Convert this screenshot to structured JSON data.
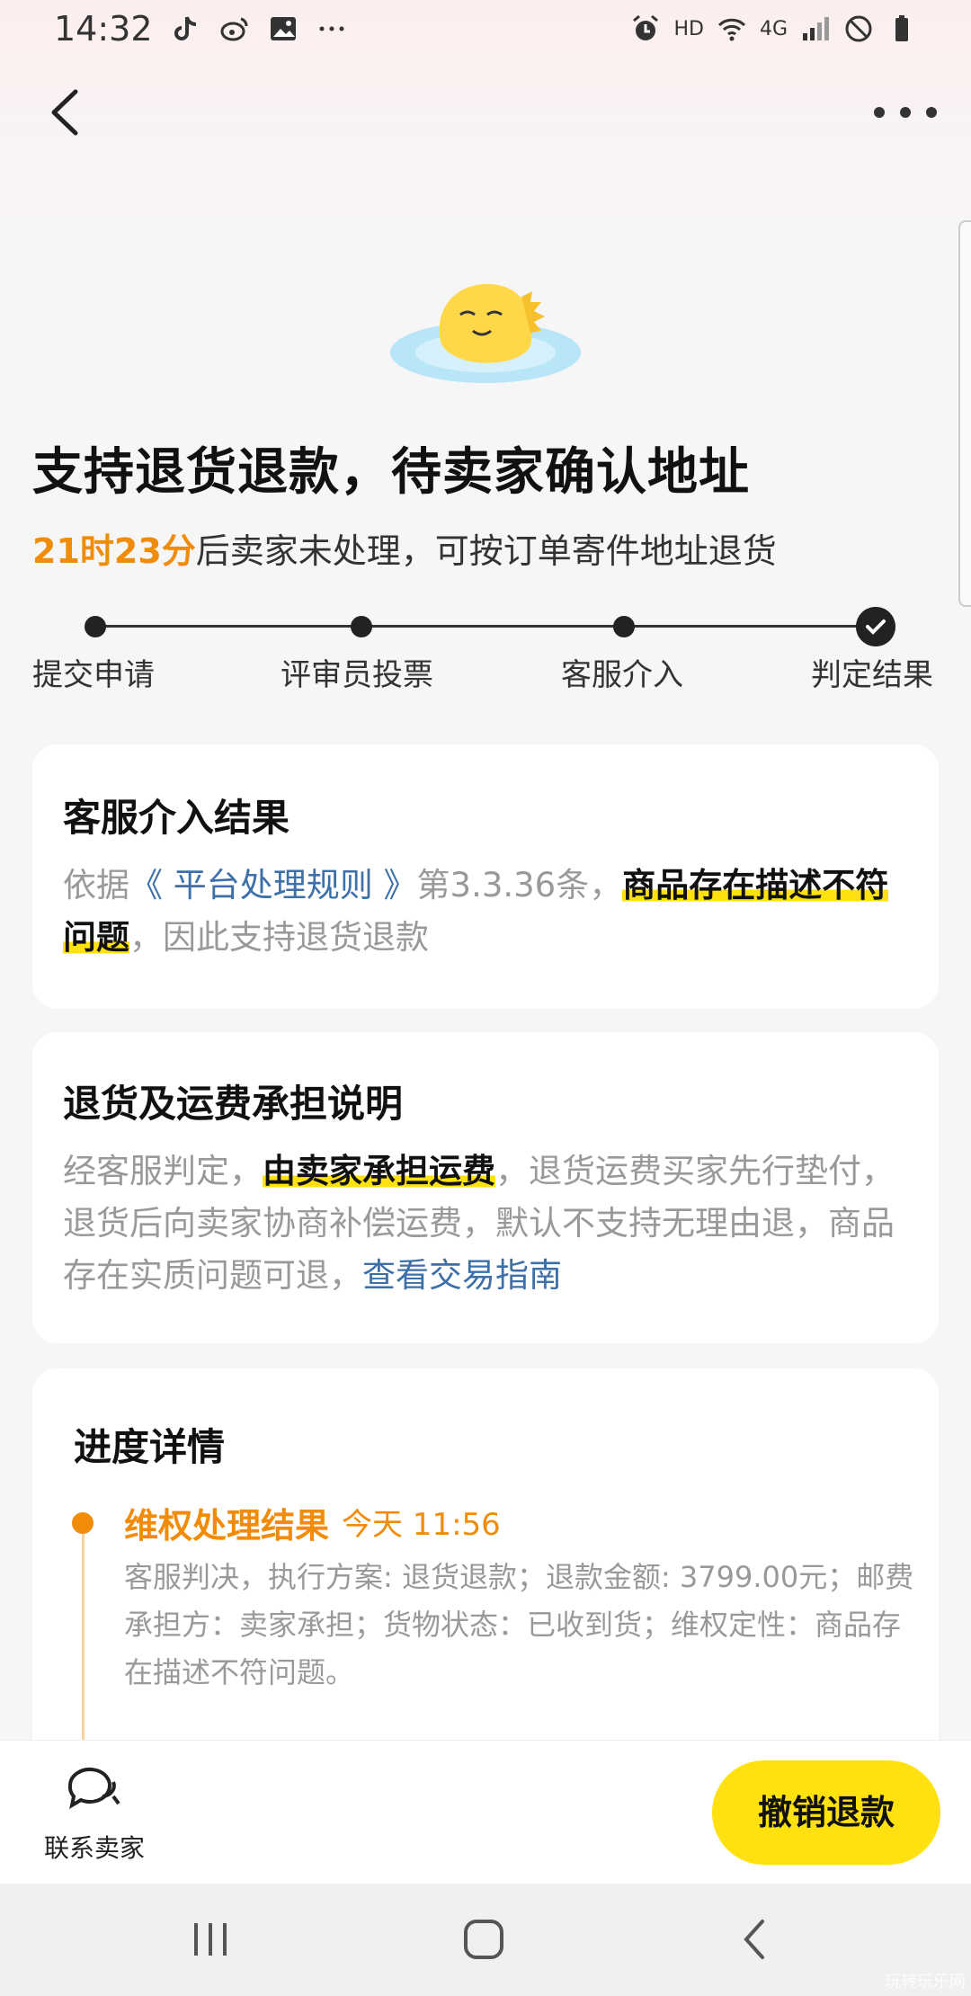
{
  "status_bar": {
    "time": "14:32",
    "hd": "HD",
    "net": "4G"
  },
  "header": {
    "title": "支持退货退款，待卖家确认地址",
    "countdown": "21时23分",
    "subtitle_rest": "后卖家未处理，可按订单寄件地址退货"
  },
  "steps": [
    {
      "label": "提交申请"
    },
    {
      "label": "评审员投票"
    },
    {
      "label": "客服介入"
    },
    {
      "label": "判定结果"
    }
  ],
  "result_card": {
    "title": "客服介入结果",
    "text_prefix": "依据",
    "rule_link": "《 平台处理规则 》",
    "text_mid": "第3.3.36条，",
    "highlight": "商品存在描述不符问题",
    "text_suffix": "，因此支持退货退款"
  },
  "shipping_card": {
    "title": "退货及运费承担说明",
    "text_prefix": "经客服判定，",
    "highlight": "由卖家承担运费",
    "text_mid": "，退货运费买家先行垫付，退货后向卖家协商补偿运费，默认不支持无理由退，商品存在实质问题可退，",
    "guide_link": "查看交易指南"
  },
  "progress_card": {
    "title": "进度详情",
    "items": [
      {
        "title": "维权处理结果",
        "time": "今天 11:56",
        "desc": "客服判决，执行方案: 退货退款；退款金额: 3799.00元；邮费承担方：卖家承担；货物状态：已收到货；维权定性：商品存在描述不符问题。"
      }
    ]
  },
  "bottom_bar": {
    "contact_label": "联系卖家",
    "cancel_label": "撤销退款"
  },
  "icons": {
    "back": "back-arrow-icon",
    "more": "more-dots-icon",
    "contact": "chat-bubbles-icon",
    "step_done": "check-icon"
  },
  "colors": {
    "accent_orange": "#f08c0a",
    "button_yellow": "#ffe10f",
    "link_blue": "#3d6fa8"
  },
  "watermark": "玩转玩乐网"
}
